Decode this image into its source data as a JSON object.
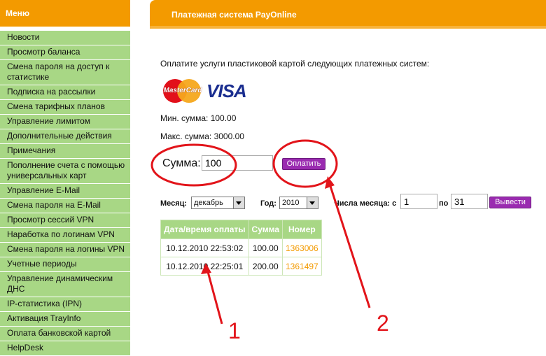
{
  "sidebar": {
    "header": "Меню",
    "items": [
      {
        "label": "Новости"
      },
      {
        "label": "Просмотр баланса"
      },
      {
        "label": "Смена пароля на доступ к статистике"
      },
      {
        "label": "Подписка на рассылки"
      },
      {
        "label": "Смена тарифных планов"
      },
      {
        "label": "Управление лимитом"
      },
      {
        "label": "Дополнительные действия"
      },
      {
        "label": "Примечания"
      },
      {
        "label": "Пополнение счета с помощью универсальных карт"
      },
      {
        "label": "Управление E-Mail"
      },
      {
        "label": "Смена пароля на E-Mail"
      },
      {
        "label": "Просмотр сессий VPN"
      },
      {
        "label": "Наработка по логинам VPN"
      },
      {
        "label": "Смена пароля на логины VPN"
      },
      {
        "label": "Учетные периоды"
      },
      {
        "label": "Управление динамическим ДНС"
      },
      {
        "label": "IP-статистика (IPN)"
      },
      {
        "label": "Активация TrayInfo"
      },
      {
        "label": "Оплата банковской картой"
      },
      {
        "label": "HelpDesk"
      }
    ]
  },
  "header": {
    "title": "Платежная система PayOnline"
  },
  "main": {
    "intro": "Оплатите услуги пластиковой картой следующих платежных систем:",
    "mastercard_text": "MasterCard",
    "visa_text": "VISA",
    "min_sum": "Мин. сумма: 100.00",
    "max_sum": "Макс. сумма: 3000.00",
    "sum_label": "Сумма:",
    "sum_value": "100",
    "pay_button": "Оплатить"
  },
  "filters": {
    "month_label": "Месяц:",
    "month_value": "декабрь",
    "year_label": "Год:",
    "year_value": "2010",
    "days_label": "Числа месяца: с",
    "day_from": "1",
    "to_label": "по",
    "day_to": "31",
    "show_button": "Вывести"
  },
  "table": {
    "headers": [
      "Дата/время оплаты",
      "Сумма",
      "Номер"
    ],
    "rows": [
      {
        "datetime": "10.12.2010 22:53:02",
        "sum": "100.00",
        "number": "1363006"
      },
      {
        "datetime": "10.12.2010 22:25:01",
        "sum": "200.00",
        "number": "1361497"
      }
    ]
  },
  "annotations": {
    "label_1": "1",
    "label_2": "2",
    "color": "#e2141a"
  },
  "colors": {
    "accent_orange": "#f39a00",
    "menu_green": "#a8d785",
    "button_purple": "#9a2bb0"
  }
}
